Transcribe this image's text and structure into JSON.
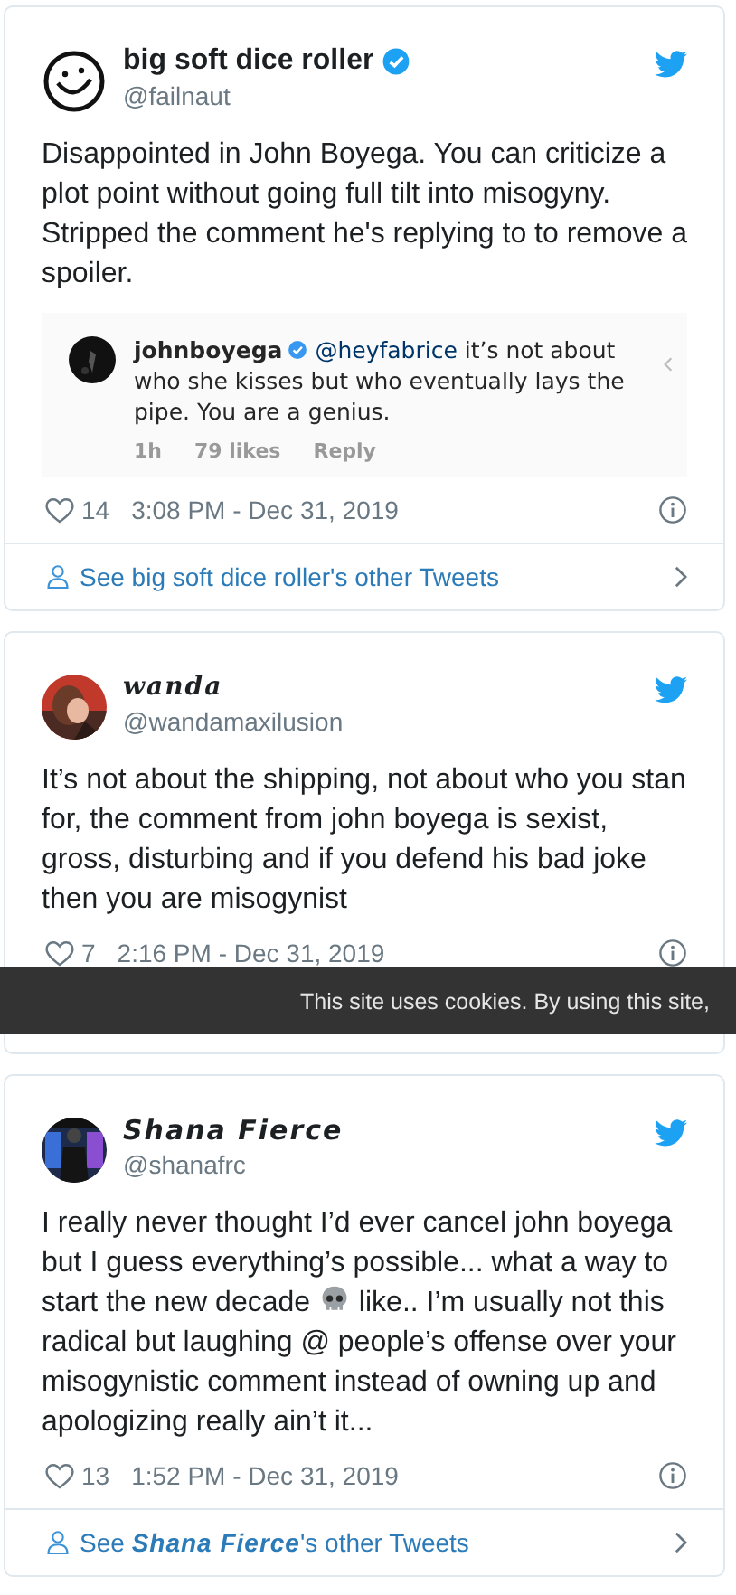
{
  "tweets": [
    {
      "avatar": {
        "kind": "smiley"
      },
      "name": {
        "text": "big soft dice roller",
        "kind": "plain"
      },
      "verified": true,
      "handle": "@failnaut",
      "body": [
        {
          "kind": "text",
          "text": "Disappointed in John Boyega. You can criticize a plot point without going full tilt into misogyny. Stripped the comment he's replying to to remove a spoiler."
        }
      ],
      "quote": {
        "user": "johnboyega",
        "verified": true,
        "mention": "@heyfabrice",
        "text": "it’s not about who she kisses but who eventually lays the pipe. You are a genius.",
        "meta": [
          "1h",
          "79 likes",
          "Reply"
        ]
      },
      "likes": "14",
      "time": "3:08 PM - Dec 31, 2019",
      "footer": "See big soft dice roller's other Tweets"
    },
    {
      "name": {
        "text": "wanda",
        "kind": "serif"
      },
      "verified": false,
      "handle": "@wandamaxilusion",
      "body": [
        {
          "kind": "text",
          "text": "It’s not about the shipping, not about who you stan for, the comment from john boyega is sexist, gross, disturbing and if you defend his bad joke then you are misogynist"
        }
      ],
      "likes": "7",
      "time": "2:16 PM - Dec 31, 2019"
    },
    {
      "name": {
        "text": "Shana Fierce",
        "kind": "italic"
      },
      "verified": false,
      "handle": "@shanafrc",
      "body": [
        {
          "kind": "text",
          "text": "I really never thought I’d ever cancel john boyega but I guess everything’s possible... what a way to start the new decade "
        },
        {
          "kind": "emoji"
        },
        {
          "kind": "text",
          "text": " like.. I’m usually not this radical but laughing @ people’s offense over your misogynistic comment instead of owning up and apologizing really ain’t it..."
        }
      ],
      "likes": "13",
      "time": "1:52 PM - Dec 31, 2019",
      "footer": "See **Shana Fierce**'s other Tweets"
    }
  ],
  "cookie_banner": {
    "text": "This site uses cookies. By using this site,"
  }
}
